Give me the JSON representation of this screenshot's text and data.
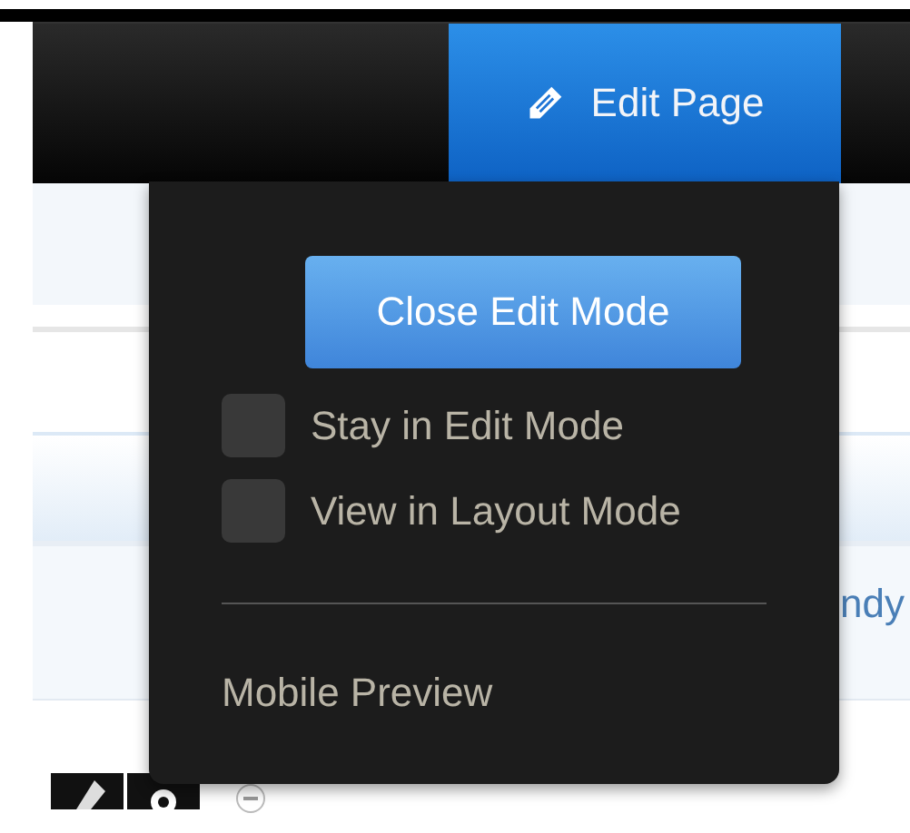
{
  "toolbar": {
    "edit_button": {
      "label": "Edit Page",
      "expanded": true
    }
  },
  "edit_menu": {
    "close_button": "Close Edit Mode",
    "options": [
      {
        "label": "Stay in Edit Mode",
        "checked": false
      },
      {
        "label": "View in Layout Mode",
        "checked": false
      }
    ],
    "link": "Mobile Preview"
  },
  "page": {
    "partial_text": "ndy"
  }
}
